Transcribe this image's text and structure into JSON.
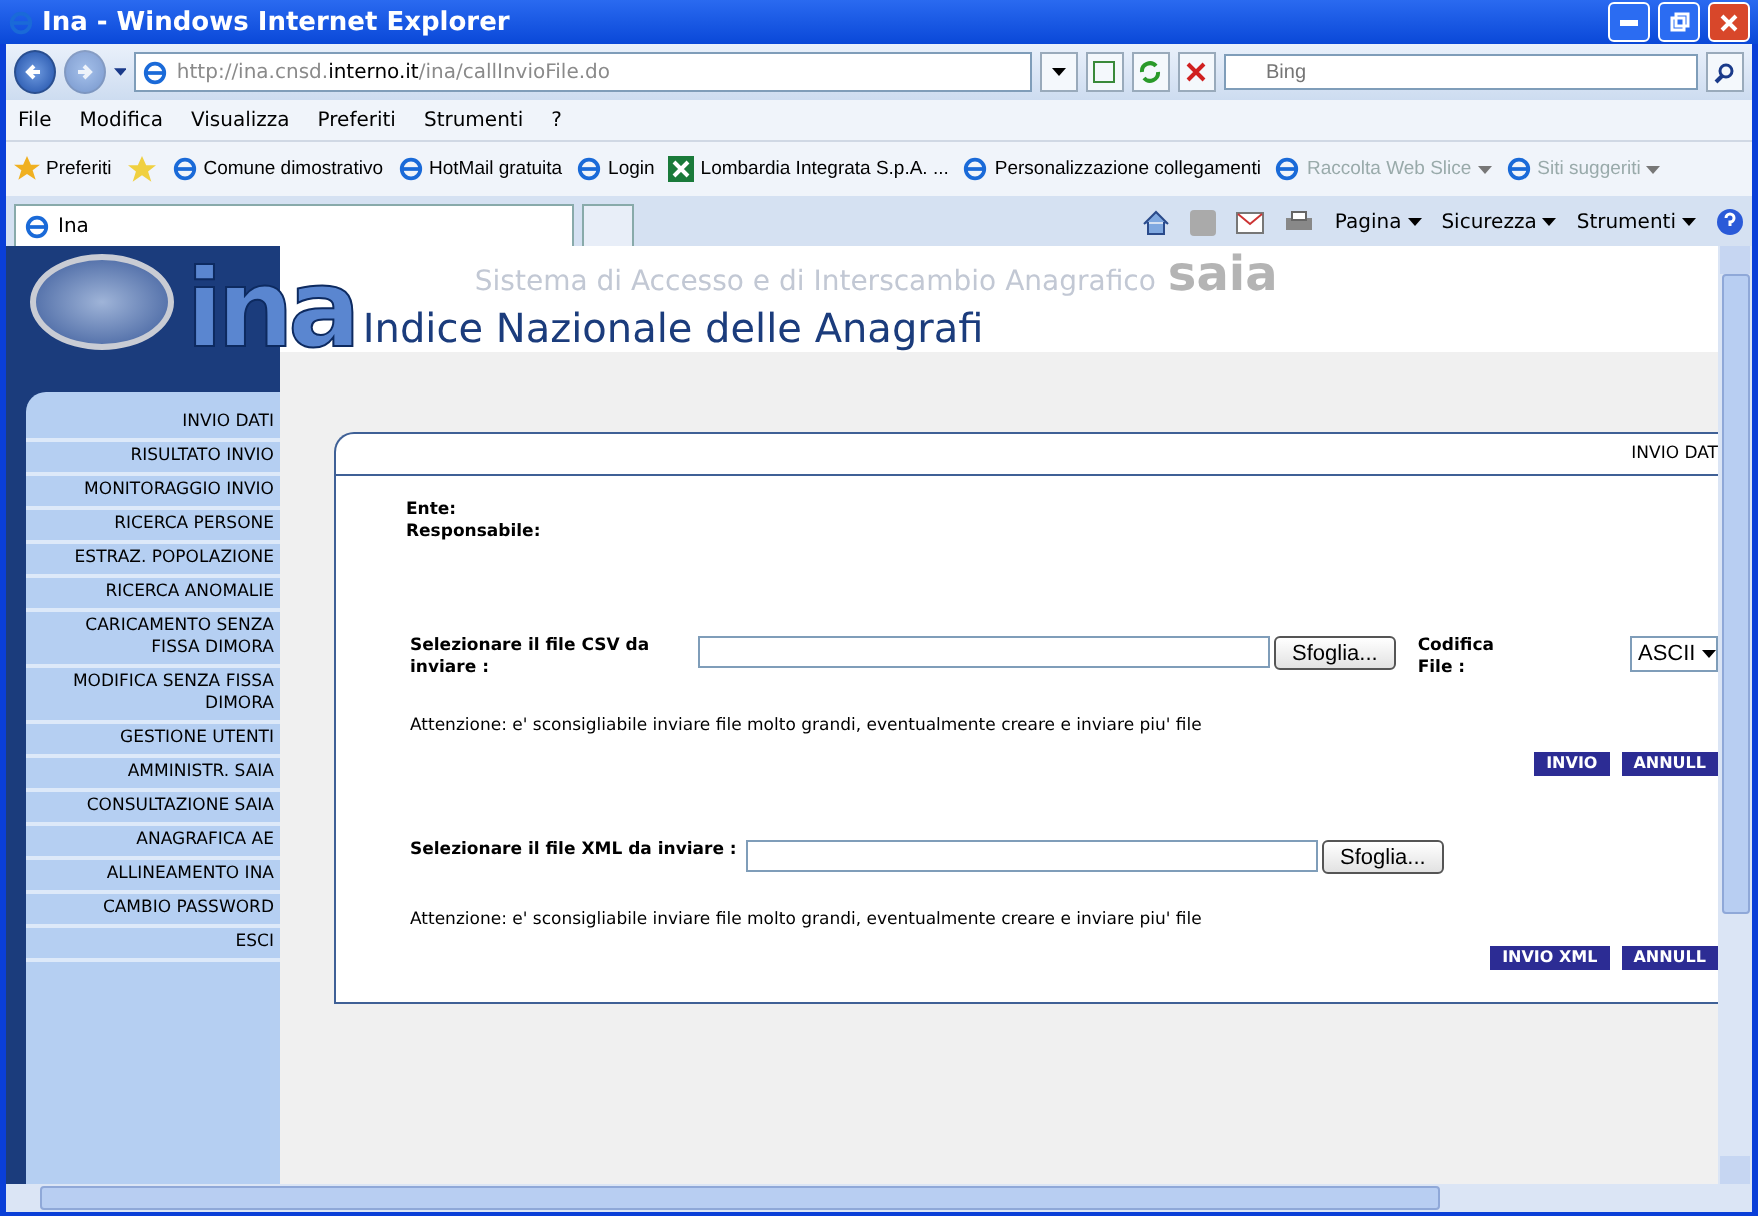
{
  "window": {
    "title": "Ina - Windows Internet Explorer"
  },
  "address": {
    "url_prefix": "http://ina.cnsd.",
    "url_domain": "interno.it",
    "url_path": "/ina/callInvioFile.do"
  },
  "search": {
    "placeholder": "Bing"
  },
  "menu": [
    "File",
    "Modifica",
    "Visualizza",
    "Preferiti",
    "Strumenti",
    "?"
  ],
  "favorites": {
    "label": "Preferiti",
    "links": [
      {
        "label": "Comune dimostrativo",
        "kind": "page",
        "disabled": false,
        "dropdown": false
      },
      {
        "label": "HotMail gratuita",
        "kind": "page",
        "disabled": false,
        "dropdown": false
      },
      {
        "label": "Login",
        "kind": "page",
        "disabled": false,
        "dropdown": false
      },
      {
        "label": "Lombardia Integrata S.p.A. ...",
        "kind": "site",
        "disabled": false,
        "dropdown": false
      },
      {
        "label": "Personalizzazione collegamenti",
        "kind": "page",
        "disabled": false,
        "dropdown": false
      },
      {
        "label": "Raccolta Web Slice",
        "kind": "page",
        "disabled": true,
        "dropdown": true
      },
      {
        "label": "Siti suggeriti",
        "kind": "page",
        "disabled": true,
        "dropdown": true
      }
    ]
  },
  "tabs": [
    {
      "label": "Ina",
      "selected": true
    }
  ],
  "command_bar": [
    "Pagina",
    "Sicurezza",
    "Strumenti"
  ],
  "header": {
    "logo": "ina",
    "subtitle": "Sistema di Accesso e di Interscambio Anagrafico",
    "brand": "saia",
    "title": "Indice Nazionale delle Anagrafi"
  },
  "sidebar": {
    "items": [
      "INVIO DATI",
      "RISULTATO INVIO",
      "MONITORAGGIO INVIO",
      "RICERCA PERSONE",
      "ESTRAZ. POPOLAZIONE",
      "RICERCA ANOMALIE",
      "CARICAMENTO SENZA FISSA DIMORA",
      "MODIFICA SENZA FISSA DIMORA",
      "GESTIONE UTENTI",
      "AMMINISTR. SAIA",
      "CONSULTAZIONE SAIA",
      "ANAGRAFICA AE",
      "ALLINEAMENTO INA",
      "CAMBIO PASSWORD",
      "ESCI"
    ]
  },
  "panel": {
    "title": "INVIO DAT",
    "info": [
      "Ente:",
      "Responsabile:"
    ],
    "csv": {
      "label": "Selezionare il file CSV da inviare :",
      "browse": "Sfoglia...",
      "encoding_label": "Codifica File :",
      "encoding_value": "ASCII",
      "warning": "Attenzione: e' sconsigliabile inviare file molto grandi, eventualmente creare e inviare piu' file",
      "buttons": [
        "INVIO",
        "ANNULL"
      ]
    },
    "xml": {
      "label": "Selezionare il file XML da inviare :",
      "browse": "Sfoglia...",
      "warning": "Attenzione: e' sconsigliabile inviare file molto grandi, eventualmente creare e inviare piu' file",
      "buttons": [
        "INVIO XML",
        "ANNULL"
      ]
    }
  }
}
